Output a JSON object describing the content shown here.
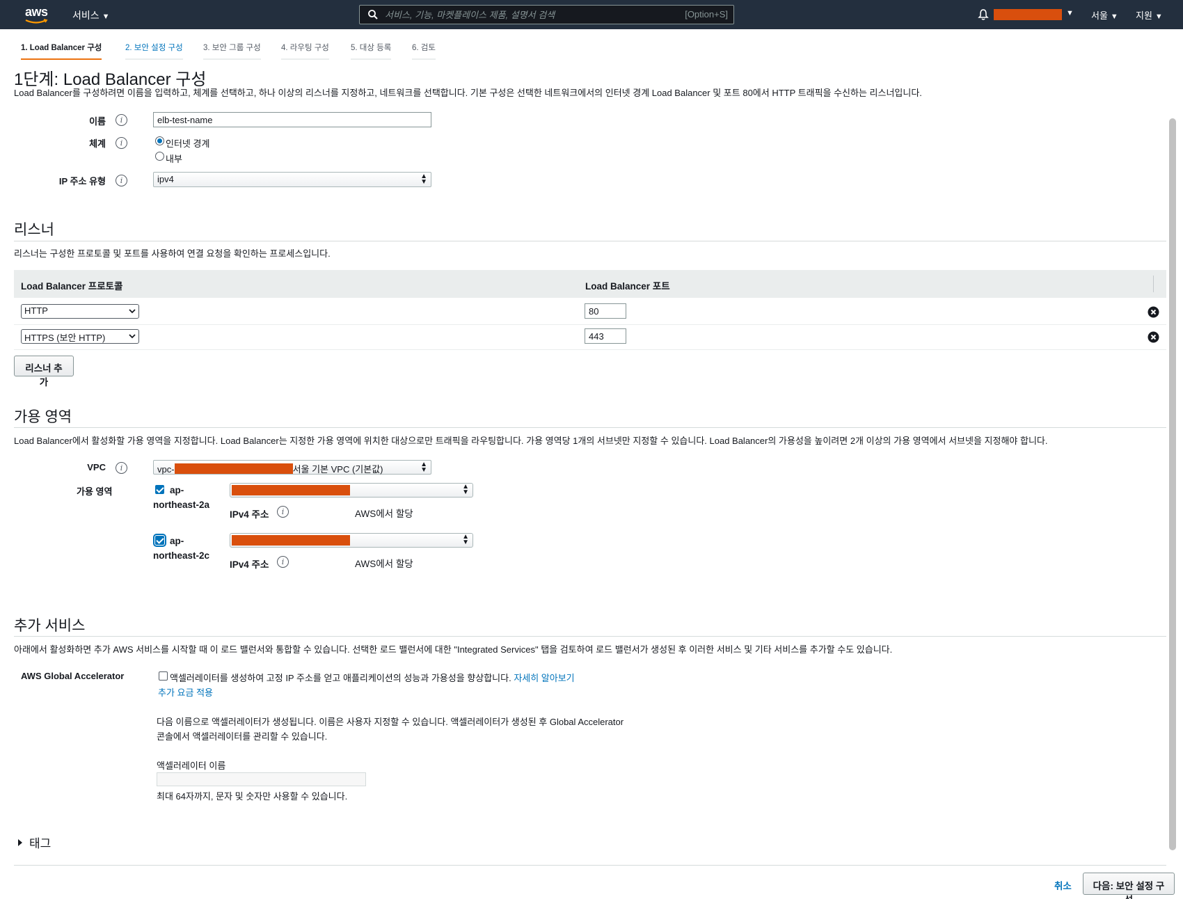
{
  "topbar": {
    "logo": "aws",
    "services_label": "서비스",
    "search_placeholder": "서비스, 기능, 마켓플레이스 제품, 설명서 검색",
    "search_shortcut": "[Option+S]",
    "region_label": "서울",
    "support_label": "지원"
  },
  "tabs": [
    {
      "label": "1. Load Balancer 구성"
    },
    {
      "label": "2. 보안 설정 구성"
    },
    {
      "label": "3. 보안 그룹 구성"
    },
    {
      "label": "4. 라우팅 구성"
    },
    {
      "label": "5. 대상 등록"
    },
    {
      "label": "6. 검토"
    }
  ],
  "page": {
    "title": "1단계: Load Balancer 구성",
    "description": "Load Balancer를 구성하려면 이름을 입력하고, 체계를 선택하고, 하나 이상의 리스너를 지정하고, 네트워크를 선택합니다. 기본 구성은 선택한 네트워크에서의 인터넷 경계 Load Balancer 및 포트 80에서 HTTP 트래픽을 수신하는 리스너입니다."
  },
  "basic": {
    "name_label": "이름",
    "name_value": "elb-test-name",
    "scheme_label": "체계",
    "scheme_options": [
      "인터넷 경계",
      "내부"
    ],
    "scheme_selected": "인터넷 경계",
    "ip_type_label": "IP 주소 유형",
    "ip_type_value": "ipv4"
  },
  "listeners": {
    "title": "리스너",
    "description": "리스너는 구성한 프로토콜 및 포트를 사용하여 연결 요청을 확인하는 프로세스입니다.",
    "col_protocol": "Load Balancer 프로토콜",
    "col_port": "Load Balancer 포트",
    "rows": [
      {
        "protocol": "HTTP",
        "port": "80"
      },
      {
        "protocol": "HTTPS (보안 HTTP)",
        "port": "443"
      }
    ],
    "add_button": "리스너 추가"
  },
  "az": {
    "title": "가용 영역",
    "description": "Load Balancer에서 활성화할 가용 영역을 지정합니다. Load Balancer는 지정한 가용 영역에 위치한 대상으로만 트래픽을 라우팅합니다. 가용 영역당 1개의 서브넷만 지정할 수 있습니다. Load Balancer의 가용성을 높이려면 2개 이상의 가용 영역에서 서브넷을 지정해야 합니다.",
    "vpc_label": "VPC",
    "vpc_prefix": "vpc-",
    "vpc_suffix": "서울 기본 VPC (기본값)",
    "zones_label": "가용 영역",
    "zones": [
      {
        "name_line1": "ap-",
        "name_line2": "northeast-2a",
        "checked": true,
        "ipv4_label": "IPv4 주소",
        "ipv4_value": "AWS에서 할당"
      },
      {
        "name_line1": "ap-",
        "name_line2": "northeast-2c",
        "checked": true,
        "ipv4_label": "IPv4 주소",
        "ipv4_value": "AWS에서 할당"
      }
    ]
  },
  "addons": {
    "title": "추가 서비스",
    "description": "아래에서 활성화하면 추가 AWS 서비스를 시작할 때 이 로드 밸런서와 통합할 수 있습니다. 선택한 로드 밸런서에 대한 \"Integrated Services\" 탭을 검토하여 로드 밸런서가 생성된 후 이러한 서비스 및 기타 서비스를 추가할 수도 있습니다.",
    "ga_label": "AWS Global Accelerator",
    "ga_checkbox_text": "액셀러레이터를 생성하여 고정 IP 주소를 얻고 애플리케이션의 성능과 가용성을 향상합니다.",
    "ga_learn_more": "자세히 알아보기",
    "ga_extra_charge": "추가 요금 적용",
    "ga_info_line1": "다음 이름으로 액셀러레이터가 생성됩니다. 이름은 사용자 지정할 수 있습니다. 액셀러레이터가 생성된 후 Global Accelerator",
    "ga_info_line2": "콘솔에서 액셀러레이터를 관리할 수 있습니다.",
    "accel_name_label": "액셀러레이터 이름",
    "accel_name_value": "",
    "accel_hint": "최대 64자까지, 문자 및 숫자만 사용할 수 있습니다."
  },
  "tags": {
    "label": "태그"
  },
  "footer": {
    "cancel": "취소",
    "next": "다음: 보안 설정 구성"
  },
  "colors": {
    "nav_bg": "#232f3e",
    "link": "#0073bb",
    "redaction": "#d94f0d",
    "active_tab": "#ec7211"
  }
}
